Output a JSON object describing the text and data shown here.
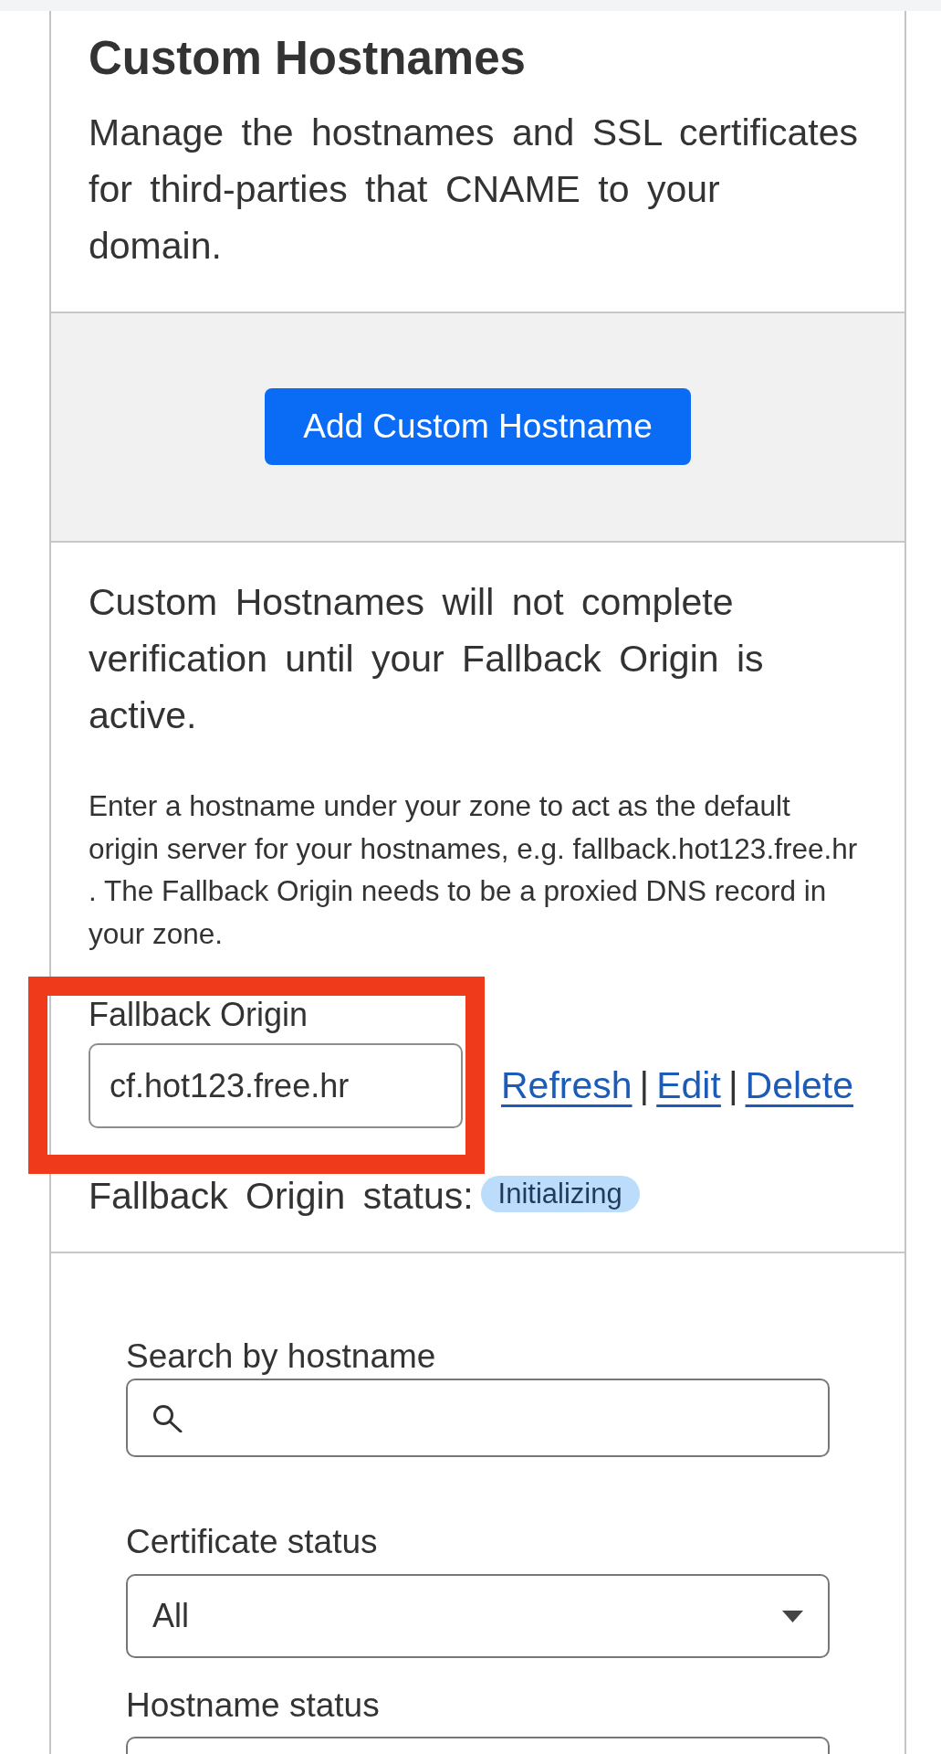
{
  "header": {
    "title": "Custom Hostnames",
    "description": "Manage the hostnames and SSL certificates for third-parties that CNAME to your domain."
  },
  "add_button": {
    "label": "Add Custom Hostname"
  },
  "fallback_origin": {
    "notice": "Custom Hostnames will not complete verification until your Fallback Origin is active.",
    "help": "Enter a hostname under your zone to act as the default origin server for your hostnames, e.g. fallback.hot123.free.hr . The Fallback Origin needs to be a proxied DNS record in your zone.",
    "label": "Fallback Origin",
    "value": "cf.hot123.free.hr",
    "highlighted": true,
    "actions": [
      {
        "kind": "link",
        "text": "Refresh"
      },
      {
        "kind": "separator",
        "text": "|"
      },
      {
        "kind": "link",
        "text": "Edit"
      },
      {
        "kind": "separator",
        "text": "|"
      },
      {
        "kind": "link",
        "text": "Delete"
      }
    ],
    "status_label": "Fallback Origin status:",
    "status_badge": "Initializing"
  },
  "filters": [
    {
      "kind": "search",
      "label": "Search by hostname"
    },
    {
      "kind": "select",
      "label": "Certificate status",
      "value": "All"
    },
    {
      "kind": "select",
      "label": "Hostname status"
    }
  ]
}
